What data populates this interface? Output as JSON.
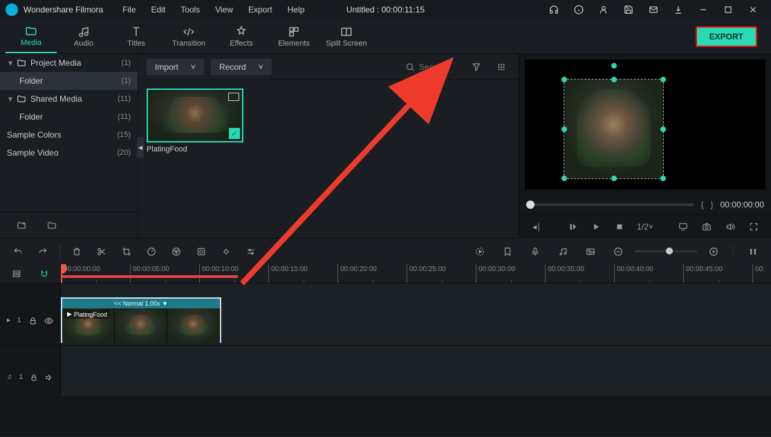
{
  "app": {
    "title": "Wondershare Filmora"
  },
  "doc": {
    "title": "Untitled : 00:00:11:15"
  },
  "menu": [
    "File",
    "Edit",
    "Tools",
    "View",
    "Export",
    "Help"
  ],
  "tabs": [
    {
      "id": "media",
      "label": "Media",
      "active": true
    },
    {
      "id": "audio",
      "label": "Audio"
    },
    {
      "id": "titles",
      "label": "Titles"
    },
    {
      "id": "transition",
      "label": "Transition"
    },
    {
      "id": "effects",
      "label": "Effects"
    },
    {
      "id": "elements",
      "label": "Elements"
    },
    {
      "id": "split",
      "label": "Split Screen"
    }
  ],
  "exportLabel": "EXPORT",
  "side": {
    "groups": [
      {
        "label": "Project Media",
        "count": "(1)",
        "expanded": true,
        "children": [
          {
            "label": "Folder",
            "count": "(1)",
            "selected": true
          }
        ]
      },
      {
        "label": "Shared Media",
        "count": "(11)",
        "expanded": true,
        "children": [
          {
            "label": "Folder",
            "count": "(11)"
          }
        ]
      }
    ],
    "extras": [
      {
        "label": "Sample Colors",
        "count": "(15)"
      },
      {
        "label": "Sample Video",
        "count": "(20)"
      }
    ]
  },
  "browser": {
    "import": "Import",
    "record": "Record",
    "searchPlaceholder": "Search",
    "clip": {
      "name": "PlatingFood"
    }
  },
  "preview": {
    "braces": {
      "open": "{",
      "close": "}"
    },
    "time": "00:00:00:00",
    "speed": "1/2"
  },
  "ruler": [
    "00:00:00:00",
    "00:00:05:00",
    "00:00:10:00",
    "00:00:15:00",
    "00:00:20:00",
    "00:00:25:00",
    "00:00:30:00",
    "00:00:35:00",
    "00:00:40:00",
    "00:00:45:00",
    "00:"
  ],
  "timeline": {
    "videoTrack": "1",
    "audioTrack": "1",
    "clipHeader": "<< Normal 1.00x ▼",
    "clipName": "PlatingFood"
  }
}
